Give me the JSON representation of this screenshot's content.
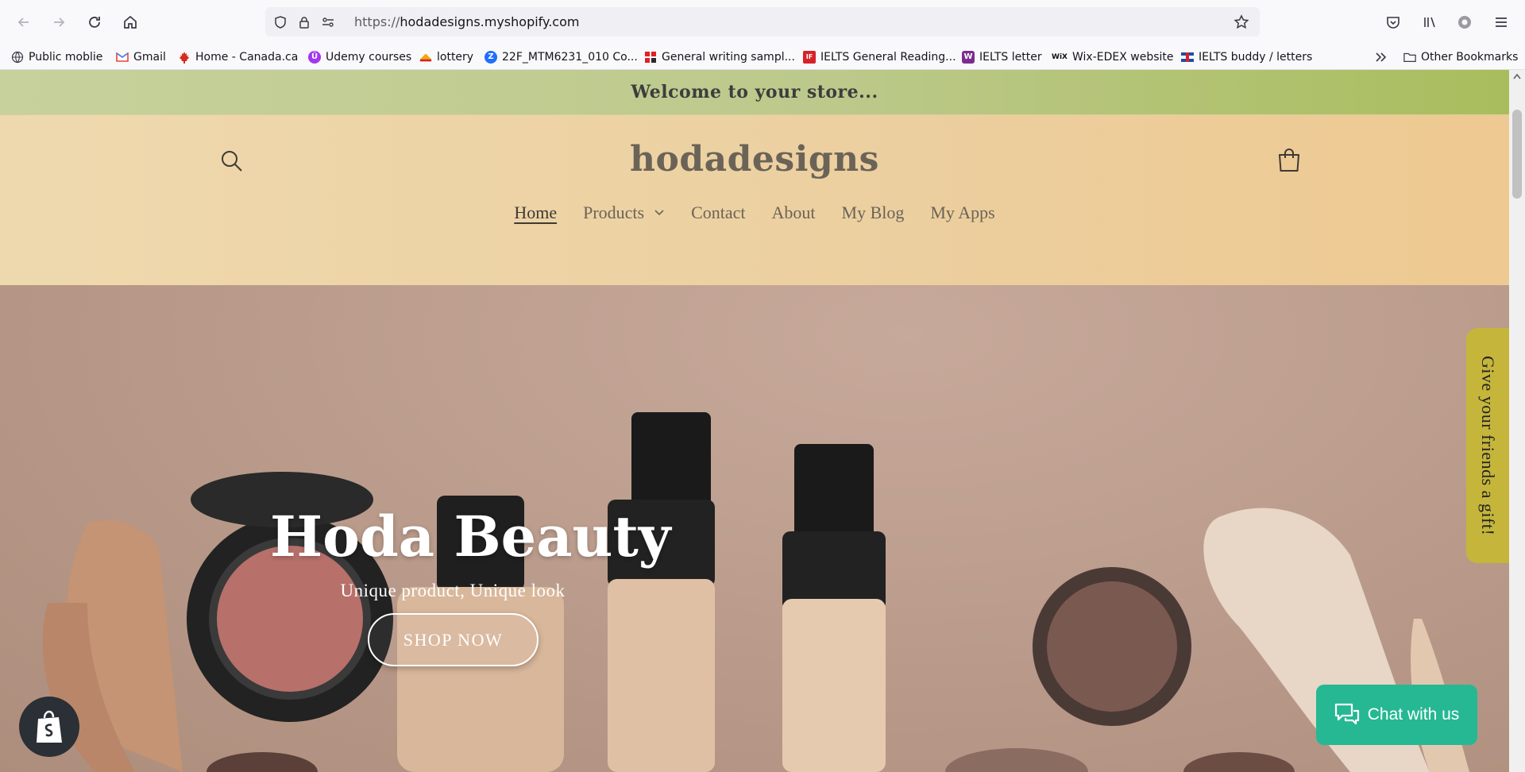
{
  "browser": {
    "url_scheme": "https://",
    "url_host": "hodadesigns.myshopify.com",
    "bookmarks": [
      {
        "label": "Public moblie",
        "icon": "globe-icon"
      },
      {
        "label": "Gmail",
        "icon": "gmail-icon"
      },
      {
        "label": "Home - Canada.ca",
        "icon": "maple-leaf-icon"
      },
      {
        "label": "Udemy courses",
        "icon": "udemy-icon"
      },
      {
        "label": "lottery",
        "icon": "lottery-icon"
      },
      {
        "label": "22F_MTM6231_010 Co...",
        "icon": "zoom-icon"
      },
      {
        "label": "General writing sampl...",
        "icon": "grid-icon"
      },
      {
        "label": "IELTS General Reading...",
        "icon": "ielts-icon"
      },
      {
        "label": "IELTS letter",
        "icon": "w-icon"
      },
      {
        "label": "Wix-EDEX website",
        "icon": "wix-icon"
      },
      {
        "label": "IELTS buddy / letters",
        "icon": "flag-icon"
      }
    ],
    "other_bookmarks": "Other Bookmarks"
  },
  "store": {
    "announcement": "Welcome to your store...",
    "logo": "hodadesigns",
    "menu": [
      {
        "label": "Home",
        "active": true
      },
      {
        "label": "Products",
        "dropdown": true
      },
      {
        "label": "Contact"
      },
      {
        "label": "About"
      },
      {
        "label": "My Blog"
      },
      {
        "label": "My Apps"
      }
    ]
  },
  "hero": {
    "title": "Hoda Beauty",
    "subtitle": "Unique product, Unique look",
    "button": "SHOP NOW"
  },
  "widgets": {
    "gift_tab": "Give your friends a gift!",
    "chat": "Chat with us"
  },
  "colors": {
    "announcement_bg": "#bcc98b",
    "header_bg": "#eed3a5",
    "hero_bg": "#b99a8a",
    "gift_tab": "#c5b63b",
    "chat": "#25b893"
  }
}
